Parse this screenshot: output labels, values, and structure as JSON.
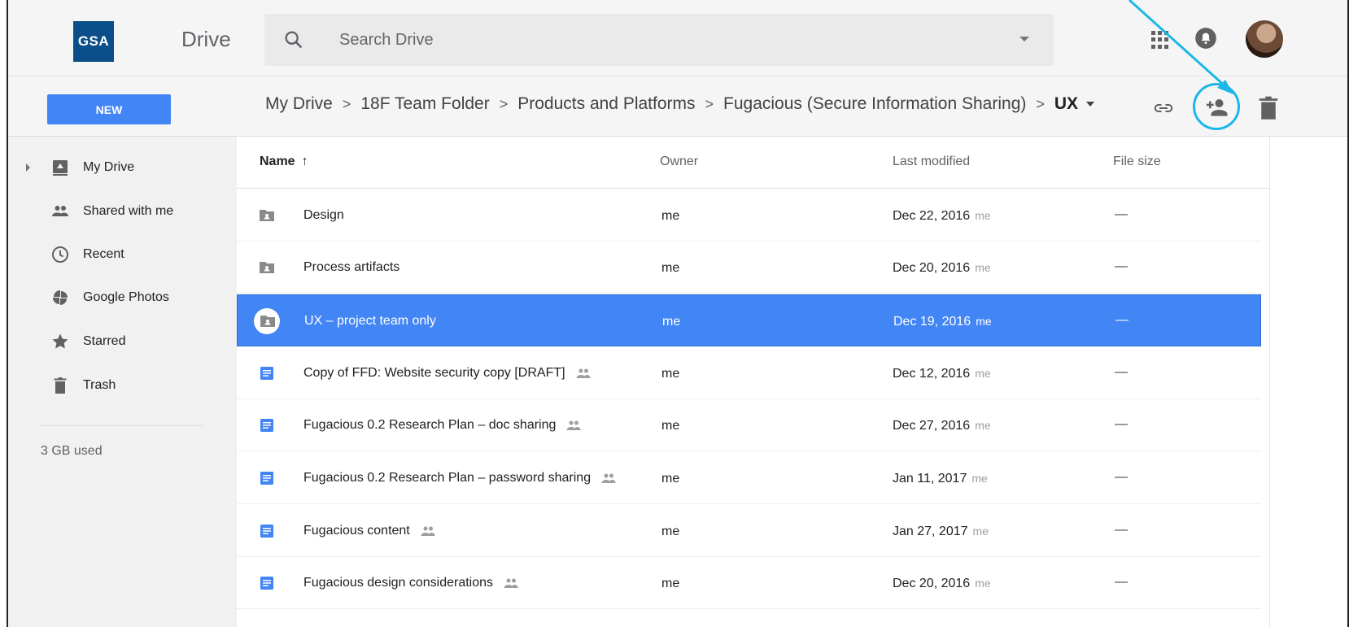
{
  "header": {
    "logo_text": "GSA",
    "app_title": "Drive",
    "search_placeholder": "Search Drive"
  },
  "toolbar": {
    "new_label": "NEW",
    "breadcrumb": [
      "My Drive",
      "18F Team Folder",
      "Products and Platforms",
      "Fugacious (Secure Information Sharing)"
    ],
    "current_folder": "UX",
    "separator": ">"
  },
  "sidebar": {
    "items": [
      {
        "label": "My Drive",
        "icon": "my-drive-icon"
      },
      {
        "label": "Shared with me",
        "icon": "people-icon"
      },
      {
        "label": "Recent",
        "icon": "clock-icon"
      },
      {
        "label": "Google Photos",
        "icon": "pinwheel-icon"
      },
      {
        "label": "Starred",
        "icon": "star-icon"
      },
      {
        "label": "Trash",
        "icon": "trash-icon"
      }
    ],
    "storage_text": "3 GB used"
  },
  "list": {
    "columns": {
      "name": "Name",
      "sort": "↑",
      "owner": "Owner",
      "modified": "Last modified",
      "size": "File size"
    },
    "rows": [
      {
        "name": "Design",
        "type": "shared-folder",
        "shared": false,
        "owner": "me",
        "modified": "Dec 22, 2016",
        "modified_by": "me",
        "size": "—"
      },
      {
        "name": "Process artifacts",
        "type": "shared-folder",
        "shared": false,
        "owner": "me",
        "modified": "Dec 20, 2016",
        "modified_by": "me",
        "size": "—"
      },
      {
        "name": "UX – project team only",
        "type": "shared-folder",
        "shared": false,
        "owner": "me",
        "modified": "Dec 19, 2016",
        "modified_by": "me",
        "size": "—",
        "selected": true
      },
      {
        "name": "Copy of FFD: Website security copy [DRAFT]",
        "type": "doc",
        "shared": true,
        "owner": "me",
        "modified": "Dec 12, 2016",
        "modified_by": "me",
        "size": "—"
      },
      {
        "name": "Fugacious 0.2 Research Plan – doc sharing",
        "type": "doc",
        "shared": true,
        "owner": "me",
        "modified": "Dec 27, 2016",
        "modified_by": "me",
        "size": "—"
      },
      {
        "name": "Fugacious 0.2 Research Plan – password sharing",
        "type": "doc",
        "shared": true,
        "owner": "me",
        "modified": "Jan 11, 2017",
        "modified_by": "me",
        "size": "—"
      },
      {
        "name": "Fugacious content",
        "type": "doc",
        "shared": true,
        "owner": "me",
        "modified": "Jan 27, 2017",
        "modified_by": "me",
        "size": "—"
      },
      {
        "name": "Fugacious design considerations",
        "type": "doc",
        "shared": true,
        "owner": "me",
        "modified": "Dec 20, 2016",
        "modified_by": "me",
        "size": "—"
      }
    ]
  },
  "colors": {
    "accent": "#4285f4",
    "annotation": "#1eb6e8",
    "doc_blue": "#4285f4",
    "folder_gray": "#8a8a8a"
  }
}
